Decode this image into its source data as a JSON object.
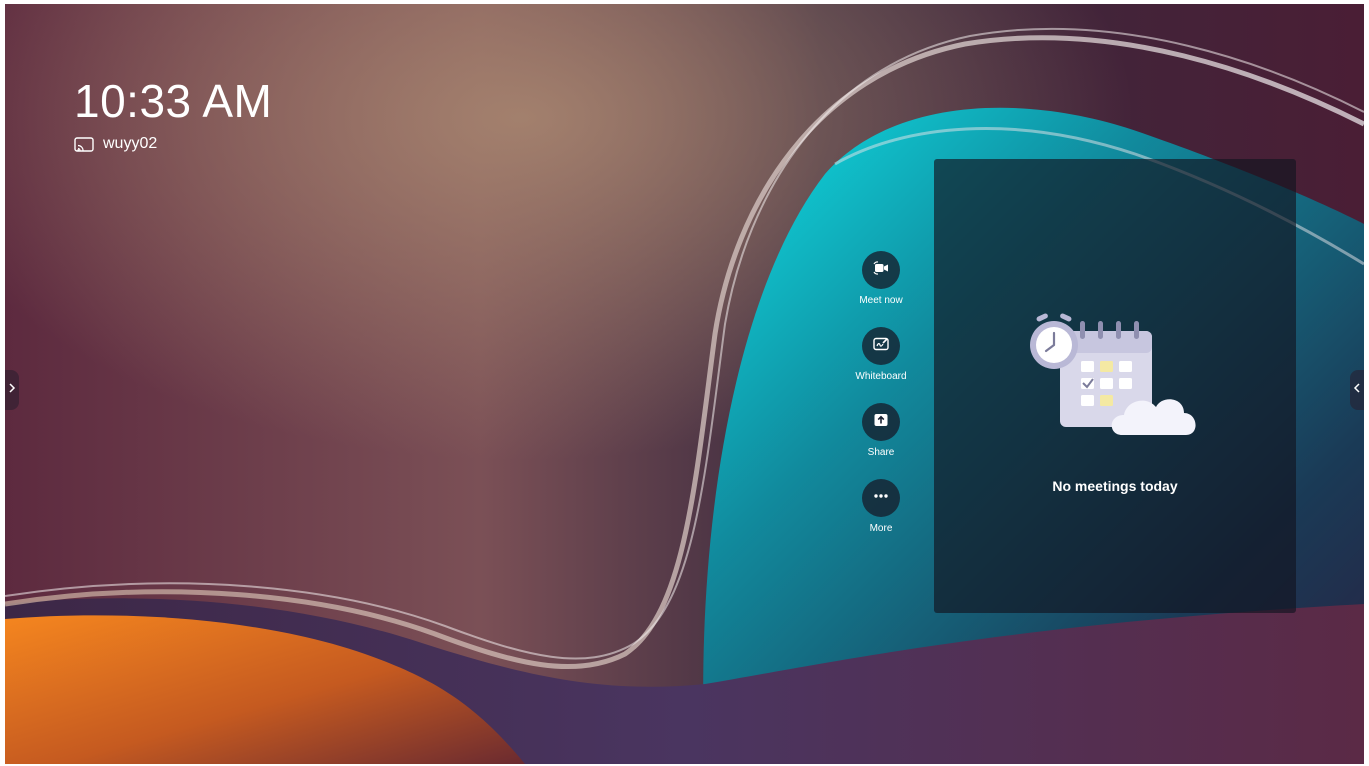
{
  "clock": {
    "time": "10:33 AM"
  },
  "device": {
    "icon": "cast-icon",
    "name": "wuyy02"
  },
  "actions": [
    {
      "id": "meet-now",
      "icon": "video-camera-icon",
      "label": "Meet now"
    },
    {
      "id": "whiteboard",
      "icon": "whiteboard-pen-icon",
      "label": "Whiteboard"
    },
    {
      "id": "share",
      "icon": "share-upload-icon",
      "label": "Share"
    },
    {
      "id": "more",
      "icon": "more-dots-icon",
      "label": "More"
    }
  ],
  "calendar_panel": {
    "illustration": "calendar-clock-cloud-illustration",
    "empty_message": "No meetings today"
  },
  "edges": {
    "left_icon": "chevron-right-icon",
    "right_icon": "chevron-left-icon"
  },
  "colors": {
    "wallpaper_magenta": "#5a2a3e",
    "wallpaper_teal": "#13b7c6",
    "wallpaper_orange": "#f07a1c",
    "panel_bg": "#121420",
    "text": "#ffffff"
  }
}
